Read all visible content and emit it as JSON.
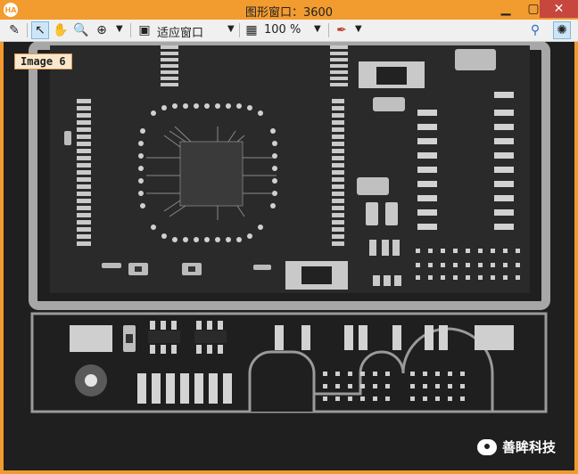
{
  "window": {
    "title": "图形窗口：3600",
    "app_badge": "HA"
  },
  "toolbar": {
    "zoom_mode_label": "适应窗口",
    "zoom_percent_label": "100 %",
    "icons": [
      "pencil-icon",
      "pointer-icon",
      "hand-icon",
      "magnifier-icon",
      "zoom-in-icon",
      "fit-window-icon",
      "zoom-percent-icon",
      "color-picker-icon",
      "pin-icon",
      "settings-icon"
    ]
  },
  "canvas": {
    "image_label": "Image 6"
  },
  "watermark": {
    "text": "善眸科技"
  },
  "colors": {
    "title_bar": "#f29b2e",
    "close_button": "#c7463d",
    "canvas_bg": "#202020"
  }
}
